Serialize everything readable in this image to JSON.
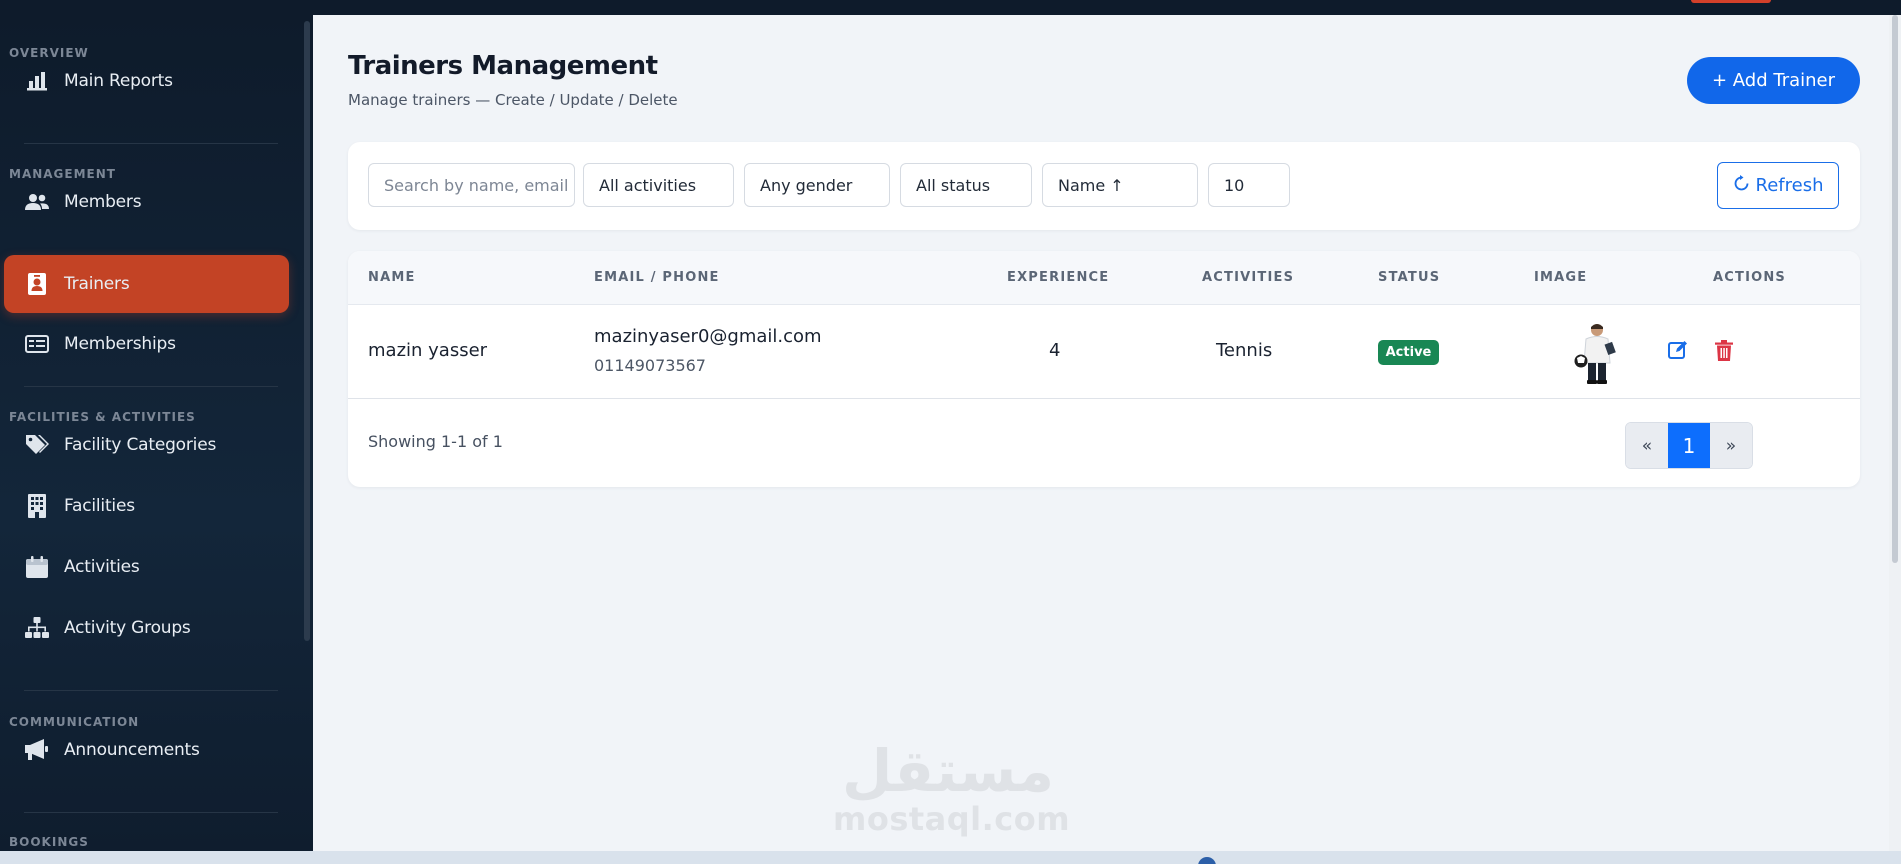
{
  "sidebar": {
    "sections": [
      {
        "label": "OVERVIEW"
      },
      {
        "label": "MANAGEMENT"
      },
      {
        "label": "FACILITIES & ACTIVITIES"
      },
      {
        "label": "COMMUNICATION"
      },
      {
        "label": "BOOKINGS"
      }
    ],
    "items": [
      {
        "label": "Main Reports",
        "icon": "bar-chart-icon"
      },
      {
        "label": "Members",
        "icon": "users-icon"
      },
      {
        "label": "Trainers",
        "icon": "id-badge-icon",
        "active": true
      },
      {
        "label": "Memberships",
        "icon": "id-card-icon"
      },
      {
        "label": "Facility Categories",
        "icon": "tags-icon"
      },
      {
        "label": "Facilities",
        "icon": "building-icon"
      },
      {
        "label": "Activities",
        "icon": "calendar-icon"
      },
      {
        "label": "Activity Groups",
        "icon": "sitemap-icon"
      },
      {
        "label": "Announcements",
        "icon": "megaphone-icon"
      }
    ]
  },
  "header": {
    "title": "Trainers Management",
    "subtitle": "Manage trainers — Create / Update / Delete",
    "add_button": "+ Add Trainer"
  },
  "filters": {
    "search_placeholder": "Search by name, email c",
    "activity": "All activities",
    "gender": "Any gender",
    "status": "All status",
    "sort": "Name ↑",
    "page_size": "10",
    "refresh_label": "Refresh"
  },
  "table": {
    "columns": [
      "NAME",
      "EMAIL / PHONE",
      "EXPERIENCE",
      "ACTIVITIES",
      "STATUS",
      "IMAGE",
      "ACTIONS"
    ],
    "rows": [
      {
        "name": "mazin yasser",
        "email": "mazinyaser0@gmail.com",
        "phone": "01149073567",
        "experience": "4",
        "activities": "Tennis",
        "status": "Active"
      }
    ]
  },
  "pagination": {
    "showing": "Showing 1-1 of 1",
    "prev": "«",
    "current": "1",
    "next": "»"
  },
  "watermark": {
    "arabic": "مستقل",
    "latin": "mostaql.com"
  },
  "colors": {
    "accent": "#1167ea",
    "active_nav": "#c34325",
    "status_active": "#198754",
    "delete": "#dc3545"
  }
}
